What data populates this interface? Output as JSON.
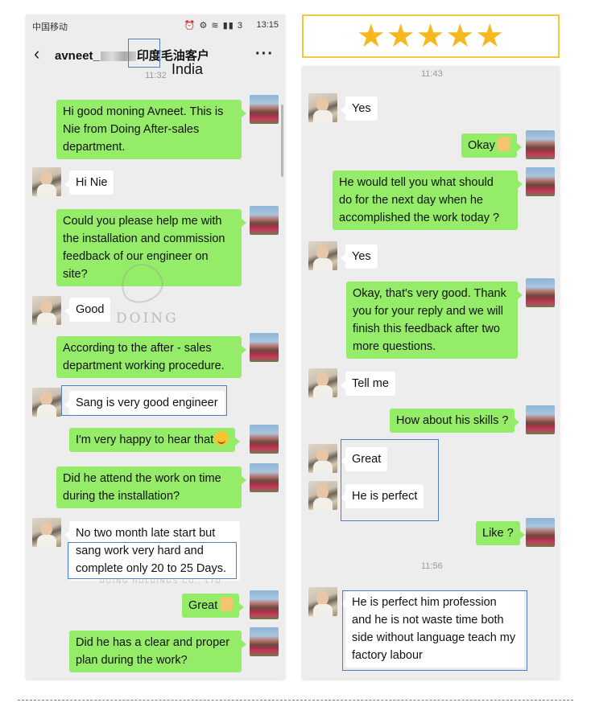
{
  "status_bar": {
    "carrier": "中国移动",
    "icons": "⏰ ⚙ ≋ ▮▮ 3",
    "time": "13:15"
  },
  "header": {
    "back_icon": "‹",
    "contact_prefix": "avneet_",
    "contact_suffix": "印度毛油客户",
    "more_icon": "···",
    "country_label": "India"
  },
  "rating": {
    "stars": "★★★★★"
  },
  "watermark": {
    "brand": "DOING",
    "company": "DOING HOLDINGS CO., LTD"
  },
  "left_chat": {
    "time": "11:32",
    "messages": [
      {
        "from": "me",
        "lines": [
          "Hi good moning Avneet. This is",
          "Nie from Doing After-sales",
          "department."
        ]
      },
      {
        "from": "them",
        "lines": [
          "Hi Nie"
        ]
      },
      {
        "from": "me",
        "lines": [
          "Could you please help me with",
          "the installation and commission",
          "feedback of our engineer on",
          "site?"
        ]
      },
      {
        "from": "them",
        "lines": [
          "Good"
        ]
      },
      {
        "from": "me",
        "lines": [
          "According to the after - sales",
          "department working procedure."
        ]
      },
      {
        "from": "them",
        "lines": [
          "Sang is very good engineer"
        ]
      },
      {
        "from": "me",
        "lines": [
          "I'm very happy to hear that"
        ]
      },
      {
        "from": "me",
        "lines": [
          "Did he attend the work on time",
          "during the installation?"
        ]
      },
      {
        "from": "them",
        "lines": [
          "No two month late start but",
          "sang work very hard and",
          "complete only 20 to 25 Days."
        ]
      },
      {
        "from": "me",
        "lines": [
          "Great"
        ]
      },
      {
        "from": "me",
        "lines": [
          "Did he has a clear and proper",
          "plan during the work?"
        ]
      }
    ]
  },
  "right_chat": {
    "time_1": "11:43",
    "time_2": "11:56",
    "messages": [
      {
        "from": "them",
        "lines": [
          "Yes"
        ]
      },
      {
        "from": "me",
        "lines": [
          "Okay"
        ]
      },
      {
        "from": "me",
        "lines": [
          "He would tell you what should",
          "do for the next day when he",
          "accomplished the work today ?"
        ]
      },
      {
        "from": "them",
        "lines": [
          "Yes"
        ]
      },
      {
        "from": "me",
        "lines": [
          "Okay, that's very good. Thank",
          "you for your reply and we will",
          "finish this feedback after two",
          "more questions."
        ]
      },
      {
        "from": "them",
        "lines": [
          "Tell me"
        ]
      },
      {
        "from": "me",
        "lines": [
          "How about his skills ?"
        ]
      },
      {
        "from": "them",
        "lines": [
          "Great"
        ]
      },
      {
        "from": "them",
        "lines": [
          "He is perfect"
        ]
      },
      {
        "from": "me",
        "lines": [
          "Like ?"
        ]
      },
      {
        "from": "them",
        "lines": [
          "He is perfect him profession",
          "and he is not waste time both",
          "side without language teach my",
          "factory labour"
        ]
      }
    ]
  }
}
